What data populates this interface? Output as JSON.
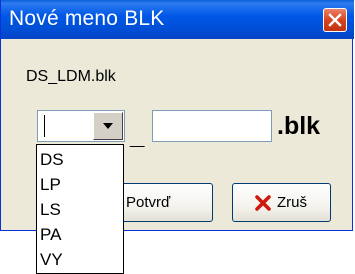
{
  "window": {
    "title": "Nové meno BLK",
    "close_icon": "close-icon"
  },
  "dialog": {
    "current_file": "DS_LDM.blk",
    "prefix_combo": {
      "value": "",
      "options": [
        "DS",
        "LP",
        "LS",
        "PA",
        "VY"
      ]
    },
    "separator": "_",
    "name_input": {
      "value": ""
    },
    "extension": ".blk"
  },
  "buttons": {
    "confirm_label": "Potvrď",
    "cancel_label": "Zruš",
    "cancel_icon": "red-x-icon"
  },
  "colors": {
    "title_bar": "#0058e6",
    "window_bg": "#ece9d8",
    "close_button": "#d9441c",
    "cancel_icon": "#d0190c"
  }
}
